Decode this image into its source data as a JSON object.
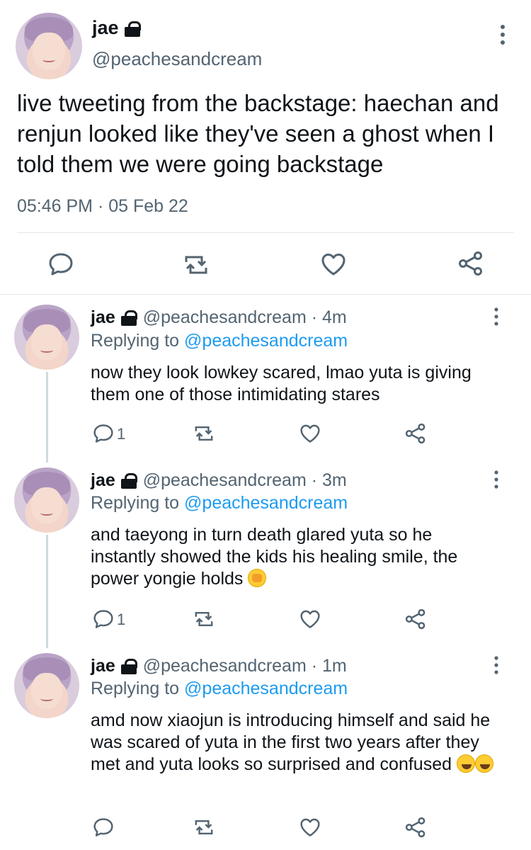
{
  "tweet": {
    "name": "jae",
    "handle": "@peachesandcream",
    "text": "live tweeting from the backstage: haechan and renjun looked like they've seen a ghost when I told them we were going backstage",
    "time": "05:46 PM",
    "dot": "·",
    "date": "05 Feb 22"
  },
  "replies": [
    {
      "name": "jae",
      "handle": "@peachesandcream",
      "age": "· 4m",
      "replying_prefix": "Replying to ",
      "replying_to": "@peachesandcream",
      "text": "now they look lowkey scared, lmao yuta is giving them one of those intimidating stares",
      "reply_count": "1"
    },
    {
      "name": "jae",
      "handle": "@peachesandcream",
      "age": "· 3m",
      "replying_prefix": "Replying to ",
      "replying_to": "@peachesandcream",
      "text": "and taeyong in turn death glared yuta so he instantly showed the kids his healing smile, the power yongie holds",
      "reply_count": "1"
    },
    {
      "name": "jae",
      "handle": "@peachesandcream",
      "age": "· 1m",
      "replying_prefix": "Replying to ",
      "replying_to": "@peachesandcream",
      "text": "amd now xiaojun is introducing himself and said he was scared of yuta in the first two years after they met and yuta looks so surprised and confused",
      "reply_count": ""
    }
  ],
  "icons": {
    "reply": "speech-bubble-icon",
    "retweet": "retweet-icon",
    "like": "heart-icon",
    "share": "share-icon",
    "more": "more-vertical-icon",
    "lock": "lock-icon"
  },
  "colors": {
    "text": "#0f1419",
    "secondary": "#536471",
    "link": "#1d9bf0",
    "thread_line": "#cfd9de"
  }
}
